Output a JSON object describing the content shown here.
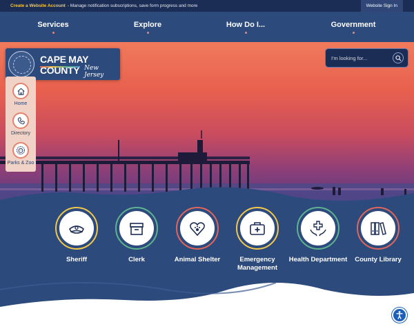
{
  "topbar": {
    "create_link": "Create a Website Account",
    "notice": "- Manage notification subscriptions, save form progress and more",
    "sign_in": "Website Sign In"
  },
  "nav": {
    "items": [
      {
        "label": "Services"
      },
      {
        "label": "Explore"
      },
      {
        "label": "How Do I..."
      },
      {
        "label": "Government"
      }
    ]
  },
  "logo": {
    "name": "CAPE MAY COUNTY",
    "subtitle": "New Jersey"
  },
  "search": {
    "placeholder": "I'm looking for..."
  },
  "quick_links": [
    {
      "label": "Home",
      "icon": "home-icon"
    },
    {
      "label": "Directory",
      "icon": "phone-icon"
    },
    {
      "label": "Parks & Zoo",
      "icon": "lion-icon"
    }
  ],
  "features": [
    {
      "label": "Sheriff",
      "icon": "sheriff-hat-icon",
      "ring": "#f4c84a"
    },
    {
      "label": "Clerk",
      "icon": "file-box-icon",
      "ring": "#5fb38e"
    },
    {
      "label": "Animal Shelter",
      "icon": "paw-heart-icon",
      "ring": "#e3665b"
    },
    {
      "label": "Emergency Management",
      "icon": "medical-kit-icon",
      "ring": "#f4c84a"
    },
    {
      "label": "Health Department",
      "icon": "hands-cross-icon",
      "ring": "#5fb38e"
    },
    {
      "label": "County Library",
      "icon": "binders-icon",
      "ring": "#e3665b"
    }
  ],
  "colors": {
    "navy": "#1c2d55",
    "nav_blue": "#2c4a7c",
    "accent_gold": "#f4c84a",
    "accent_coral": "#e3665b",
    "accent_green": "#5fb38e"
  }
}
